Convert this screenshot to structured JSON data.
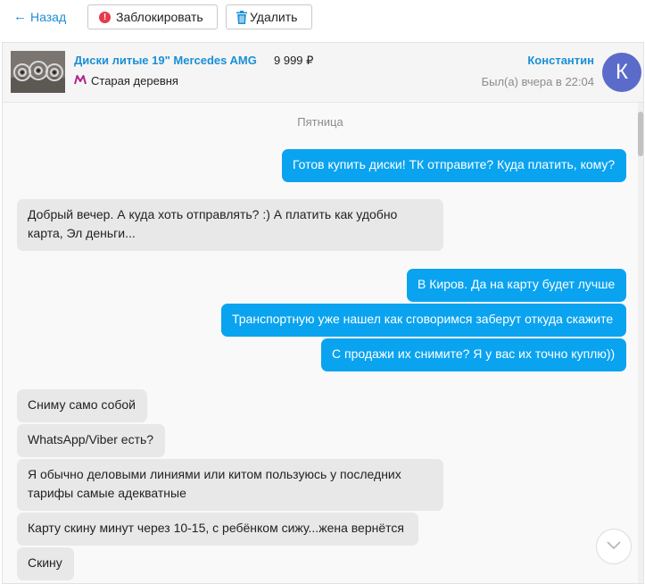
{
  "toolbar": {
    "back_label": "Назад",
    "block_label": "Заблокировать",
    "delete_label": "Удалить"
  },
  "ad": {
    "title": "Диски литые 19\" Mercedes AMG",
    "price": "9 999 ₽",
    "metro_station": "Старая деревня",
    "metro_icon": "metro-m-icon"
  },
  "contact": {
    "name": "Константин",
    "last_seen": "Был(а) вчера в 22:04",
    "avatar_letter": "К",
    "avatar_color": "#5b6bc9"
  },
  "chat": {
    "day_label": "Пятница",
    "messages": [
      {
        "direction": "out",
        "text": "Готов купить диски! ТК отправите? Куда платить, кому?"
      },
      {
        "direction": "in",
        "text": "Добрый вечер. А куда хоть отправлять? :) А платить как удобно карта, Эл деньги..."
      },
      {
        "direction": "out",
        "text": "В Киров. Да на карту будет лучше"
      },
      {
        "direction": "out",
        "text": "Транспортную уже нашел как сговоримся заберут откуда скажите"
      },
      {
        "direction": "out",
        "text": "С продажи их снимите? Я у вас их точно куплю))"
      },
      {
        "direction": "in",
        "text": "Сниму само собой"
      },
      {
        "direction": "in",
        "text": "WhatsApp/Viber есть?"
      },
      {
        "direction": "in",
        "text": "Я обычно деловыми линиями или китом пользуюсь у последних тарифы самые адекватные"
      },
      {
        "direction": "in",
        "text": "Карту скину минут через 10-15, с ребёнком сижу...жена вернётся"
      },
      {
        "direction": "in",
        "text": "Скину"
      }
    ]
  },
  "colors": {
    "accent": "#1a8fd6",
    "outgoing_bubble": "#0aa3f0",
    "incoming_bubble": "#e8e8e8",
    "block_icon": "#e43b4b"
  }
}
